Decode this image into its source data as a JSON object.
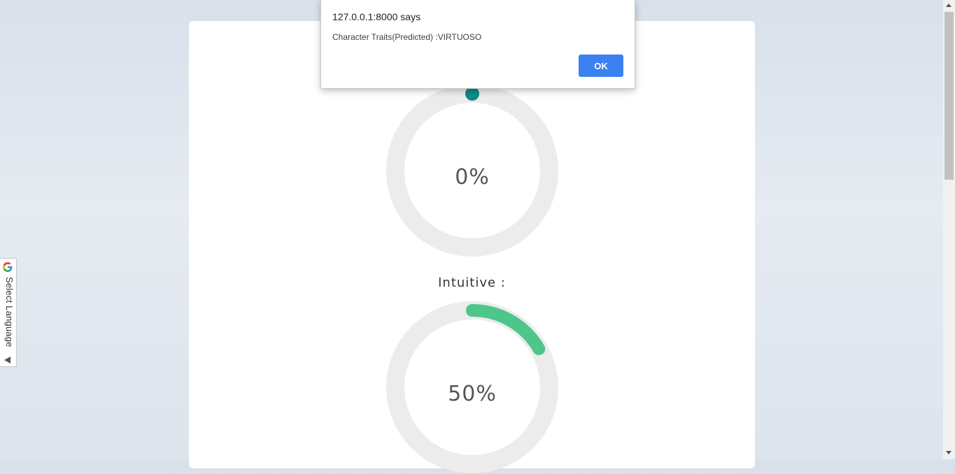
{
  "gauges": [
    {
      "label": "",
      "value_text": "0%",
      "fraction": 0.0
    },
    {
      "label": "Intuitive :",
      "value_text": "50%",
      "fraction": 0.5
    }
  ],
  "colors": {
    "track": "#ececec",
    "gauge_zero_dot": "#0d8a87",
    "gauge_fill": "#4dc68c",
    "ok_button": "#3b82f0"
  },
  "dialog": {
    "title": "127.0.0.1:8000 says",
    "message": "Character Traits(Predicted) :VIRTUOSO",
    "ok_label": "OK"
  },
  "translate_widget": {
    "label": "Select Language",
    "icon": "google-g-icon"
  },
  "scrollbar": {
    "up_icon": "scroll-up-arrow-icon",
    "down_icon": "scroll-down-arrow-icon"
  }
}
